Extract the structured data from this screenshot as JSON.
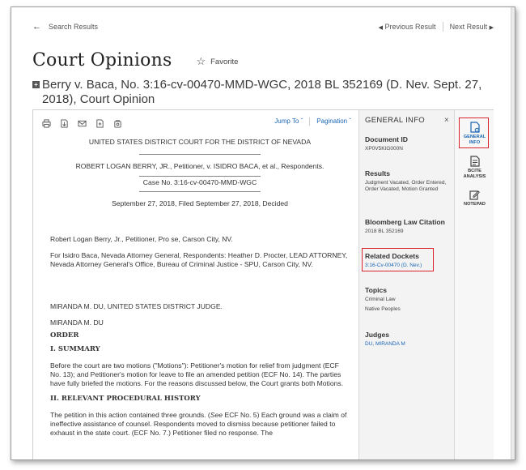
{
  "nav": {
    "back_label": "Search Results",
    "prev_label": "Previous Result",
    "next_label": "Next Result"
  },
  "header": {
    "title": "Court Opinions",
    "favorite_label": "Favorite",
    "case_title": "Berry v. Baca, No. 3:16-cv-00470-MMD-WGC, 2018 BL 352169 (D. Nev. Sept. 27, 2018), Court Opinion"
  },
  "toolbar": {
    "jump_to": "Jump To",
    "pagination": "Pagination"
  },
  "document": {
    "court": "UNITED STATES DISTRICT COURT FOR THE DISTRICT OF NEVADA",
    "parties": "ROBERT LOGAN BERRY, JR., Petitioner, v. ISIDRO BACA, et al., Respondents.",
    "case_no": "Case No. 3:16-cv-00470-MMD-WGC",
    "dates": "September 27, 2018, Filed September 27, 2018, Decided",
    "counsel_1": "Robert Logan Berry, Jr., Petitioner, Pro se, Carson City, NV.",
    "counsel_2": "For Isidro Baca, Nevada Attorney General, Respondents: Heather D. Procter, LEAD ATTORNEY, Nevada Attorney General's Office, Bureau of Criminal Justice - SPU, Carson City, NV.",
    "judge_line": "MIRANDA M. DU, UNITED STATES DISTRICT JUDGE.",
    "judge_name": "MIRANDA M. DU",
    "order_heading": "ORDER",
    "summary_heading": "I. SUMMARY",
    "summary_text": "Before the court are two motions (\"Motions\"): Petitioner's motion for relief from judgment (ECF No. 13); and Petitioner's motion for leave to file an amended petition (ECF No. 14). The parties have fully briefed the motions. For the reasons discussed below, the Court grants both Motions.",
    "history_heading": "II. RELEVANT PROCEDURAL HISTORY",
    "history_pre": "The petition in this action contained three grounds. (",
    "history_see": "See",
    "history_post": " ECF No. 5) Each ground was a claim of ineffective assistance of counsel. Respondents moved to dismiss because petitioner failed to exhaust in the state court. (ECF No. 7.) Petitioner filed no response. The"
  },
  "info": {
    "heading": "GENERAL INFO",
    "close": "×",
    "doc_id_label": "Document ID",
    "doc_id": "XP0V5KIG000N",
    "results_label": "Results",
    "results": "Judgment Vacated, Order Entered, Order Vacated, Motion Granted",
    "citation_label": "Bloomberg Law Citation",
    "citation": "2018 BL 352169",
    "dockets_label": "Related Dockets",
    "docket_link": "3:16-Cv-00470 (D. Nev.)",
    "topics_label": "Topics",
    "topic_1": "Criminal Law",
    "topic_2": "Native Peoples",
    "judges_label": "Judges",
    "judge": "DU, MIRANDA M"
  },
  "tabs": {
    "general_1": "GENERAL",
    "general_2": "INFO",
    "bcite_1": "BCITE",
    "bcite_2": "ANALYSIS",
    "notepad": "NOTEPAD"
  },
  "colors": {
    "link": "#1a66b3",
    "highlight_box": "#d9232e"
  }
}
